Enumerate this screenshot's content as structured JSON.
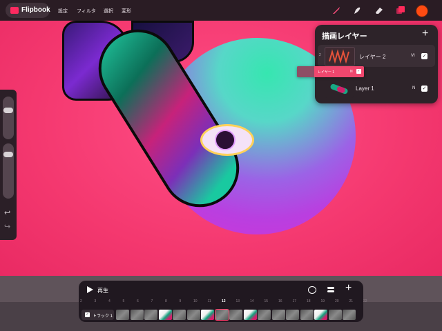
{
  "app": {
    "title": "Flipbook",
    "menu": [
      "設定",
      "フィルタ",
      "選択",
      "変形"
    ]
  },
  "toolbar": {
    "icons": [
      "brush-icon",
      "smudge-icon",
      "eraser-icon",
      "layers-icon",
      "color-swatch"
    ],
    "current_color": "#ff4b12"
  },
  "sidebar": {
    "undo_glyph": "↩",
    "redo_glyph": "↪"
  },
  "layers_panel": {
    "title": "描画レイヤー",
    "add_glyph": "+",
    "layers": [
      {
        "name": "レイヤー 2",
        "blend": "VI",
        "visible": true,
        "index": "2"
      },
      {
        "name": "Layer 1",
        "blend": "N",
        "visible": true
      }
    ],
    "drag_ghost": {
      "name": "レイヤー 1",
      "blend": "N"
    }
  },
  "timeline": {
    "play_label": "再生",
    "add_glyph": "+",
    "frame_numbers": [
      "2",
      "3",
      "4",
      "5",
      "6",
      "7",
      "8",
      "9",
      "10",
      "11",
      "12",
      "13",
      "14",
      "15",
      "16",
      "17",
      "18",
      "19",
      "20",
      "21",
      "22"
    ],
    "current_frame": "12",
    "track": {
      "name": "トラック 1",
      "enabled": true
    }
  },
  "colors": {
    "canvas_pink": "#f2366f",
    "panel_bg": "#2d2329",
    "accent": "#ff3c6a"
  }
}
